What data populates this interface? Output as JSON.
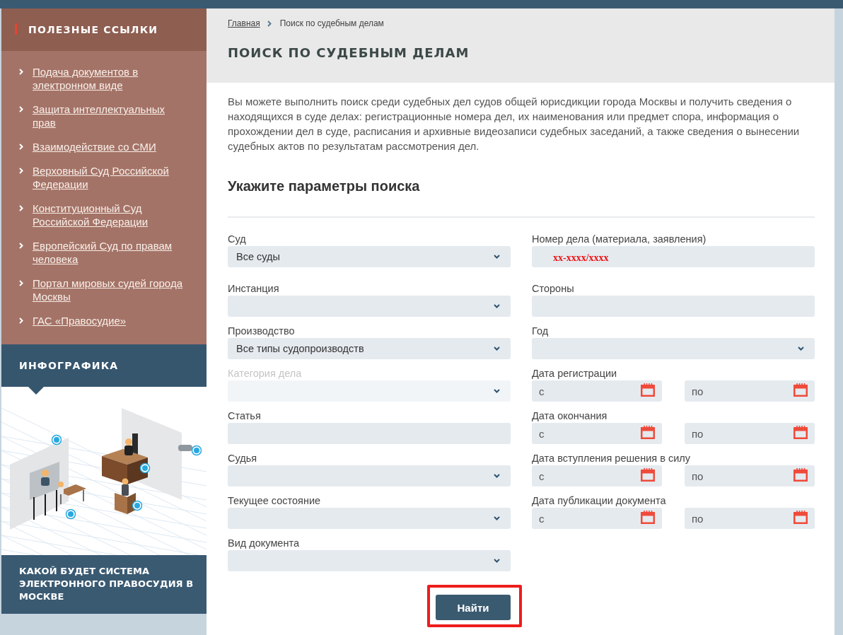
{
  "sidebar": {
    "links_title": "ПОЛЕЗНЫЕ ССЫЛКИ",
    "links": [
      "Подача документов в электронном виде",
      "Защита интеллектуальных прав",
      "Взаимодействие со СМИ",
      "Верховный Суд Российской Федерации",
      "Конституционный Суд Российской Федерации",
      "Европейский Суд по правам человека",
      "Портал мировых судей города Москвы",
      "ГАС «Правосудие»"
    ],
    "infographic_title": "ИНФОГРАФИКА",
    "promo_text": "КАКОЙ БУДЕТ СИСТЕМА ЭЛЕКТРОННОГО ПРАВОСУДИЯ В МОСКВЕ"
  },
  "breadcrumb": [
    {
      "label": "Главная",
      "link": true
    },
    {
      "label": "Поиск по судебным делам",
      "link": false
    }
  ],
  "page_title": "ПОИСК ПО СУДЕБНЫМ ДЕЛАМ",
  "intro": "Вы можете выполнить поиск среди судебных дел судов общей юрисдикции города Москвы и получить сведения о находящихся в суде делах: регистрационные номера дел, их наименования или предмет спора, информация о прохождении дел в суде, расписания и архивные видеозаписи судебных заседаний, а также сведения о вынесении судебных актов по результатам рассмотрения дел.",
  "form": {
    "title": "Укажите параметры поиска",
    "left_fields": [
      {
        "kind": "select",
        "label": "Суд",
        "value": "Все суды",
        "disabled": false
      },
      {
        "kind": "select",
        "label": "Инстанция",
        "disabled": false
      },
      {
        "kind": "select",
        "label": "Производство",
        "value": "Все типы судопроизводств",
        "disabled": false
      },
      {
        "kind": "select",
        "label": "Категория дела",
        "disabled": true
      },
      {
        "kind": "text",
        "label": "Статья",
        "disabled": false
      },
      {
        "kind": "select",
        "label": "Судья",
        "disabled": false
      },
      {
        "kind": "select",
        "label": "Текущее состояние",
        "disabled": false
      },
      {
        "kind": "select",
        "label": "Вид документа",
        "disabled": false
      }
    ],
    "right_fields": [
      {
        "kind": "text",
        "label": "Номер дела (материала, заявления)",
        "placeholder": "xx-xxxx/xxxx",
        "disabled": false
      },
      {
        "kind": "text",
        "label": "Стороны",
        "disabled": false
      },
      {
        "kind": "select",
        "label": "Год",
        "disabled": false
      },
      {
        "kind": "date_range",
        "label": "Дата регистрации",
        "from_placeholder": "с",
        "to_placeholder": "по",
        "disabled": false
      },
      {
        "kind": "date_range",
        "label": "Дата окончания",
        "from_placeholder": "с",
        "to_placeholder": "по",
        "disabled": false
      },
      {
        "kind": "date_range",
        "label": "Дата вступления решения в силу",
        "from_placeholder": "с",
        "to_placeholder": "по",
        "disabled": false
      },
      {
        "kind": "date_range",
        "label": "Дата публикации документа",
        "from_placeholder": "с",
        "to_placeholder": "по",
        "disabled": false
      }
    ],
    "submit": "Найти"
  }
}
